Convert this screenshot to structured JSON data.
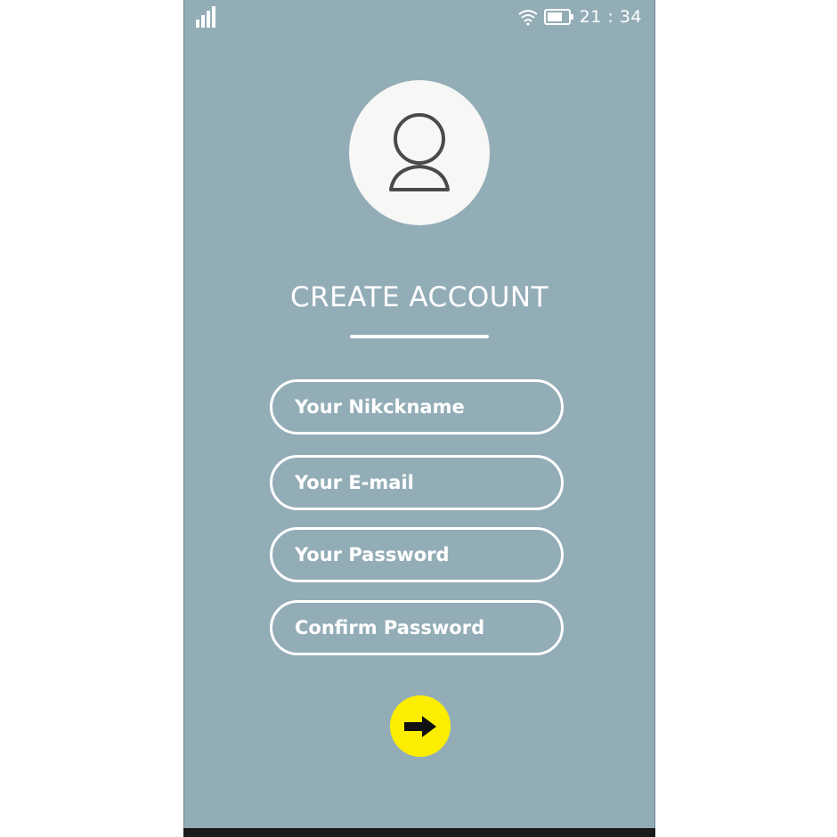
{
  "status_bar": {
    "time": "21 : 34",
    "icons": [
      "signal-icon",
      "wifi-icon",
      "battery-icon"
    ]
  },
  "avatar": {
    "icon": "user-icon"
  },
  "title": "CREATE ACCOUNT",
  "form": {
    "nickname_placeholder": "Your Nikckname",
    "email_placeholder": "Your E-mail",
    "password_placeholder": "Your Password",
    "confirm_placeholder": "Confirm Password"
  },
  "submit": {
    "icon": "arrow-right-icon"
  },
  "colors": {
    "background": "#93adb7",
    "accent": "#fcee00",
    "foreground": "#ffffff",
    "avatar_bg": "#f7f7f5"
  }
}
